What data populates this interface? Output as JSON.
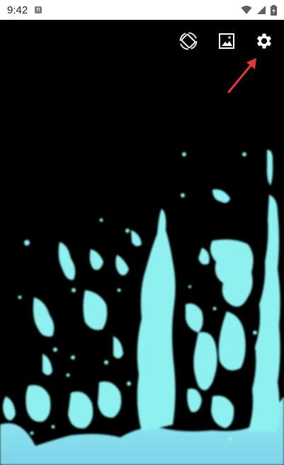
{
  "status_bar": {
    "time": "9:42",
    "icons": [
      "app-notification-icon",
      "wifi-icon",
      "signal-icon",
      "battery-icon"
    ]
  },
  "toolbar": {
    "icons": [
      "screen-rotation-icon",
      "wallpaper-image-icon",
      "settings-gear-icon"
    ]
  },
  "scene": {
    "description_colors": {
      "background": "#000000",
      "fluid": "#8FF0F0",
      "fluid_deep": "#7FD8E8"
    }
  },
  "annotation": {
    "color": "#E53935",
    "points_to": "settings-gear-icon"
  }
}
